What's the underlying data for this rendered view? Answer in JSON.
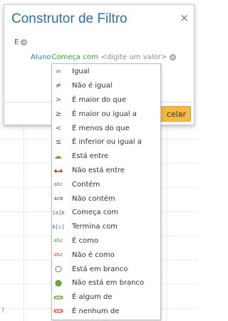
{
  "dialog": {
    "title": "Construtor de Filtro",
    "close_glyph": "×",
    "root_group": {
      "operator": "E",
      "add_glyph": "+"
    },
    "condition": {
      "field": "Aluno",
      "operator": "Começa com",
      "value_placeholder": "<digite um valor>",
      "remove_glyph": "×"
    },
    "cancel_button_label": "celar"
  },
  "background": {
    "row_digit": "7"
  },
  "menu": {
    "items": [
      {
        "label": "Igual",
        "icon": "equals-icon",
        "glyph": "="
      },
      {
        "label": "Não é igual",
        "icon": "not-equals-icon",
        "glyph": "≠"
      },
      {
        "label": "É maior do que",
        "icon": "greater-than-icon",
        "glyph": ">"
      },
      {
        "label": "É maior ou igual a",
        "icon": "greater-or-equal-icon",
        "glyph": "≥"
      },
      {
        "label": "É menos do que",
        "icon": "less-than-icon",
        "glyph": "<"
      },
      {
        "label": "É inferior ou igual a",
        "icon": "less-or-equal-icon",
        "glyph": "≤"
      },
      {
        "label": "Está entre",
        "icon": "between-icon",
        "glyph": ""
      },
      {
        "label": "Não está entre",
        "icon": "not-between-icon",
        "glyph": ""
      },
      {
        "label": "Contém",
        "icon": "contains-icon",
        "glyph": "abc"
      },
      {
        "label": "Não contém",
        "icon": "not-contains-icon",
        "glyph": "acb"
      },
      {
        "label": "Começa com",
        "icon": "begins-with-icon",
        "glyph": "[a]b"
      },
      {
        "label": "Termina com",
        "icon": "ends-with-icon",
        "glyph": "b[c]"
      },
      {
        "label": "É como",
        "icon": "like-icon",
        "glyph": "a%c"
      },
      {
        "label": "Não é como",
        "icon": "not-like-icon",
        "glyph": "a%c"
      },
      {
        "label": "Está em branco",
        "icon": "is-blank-icon",
        "glyph": ""
      },
      {
        "label": "Não está em branco",
        "icon": "is-not-blank-icon",
        "glyph": ""
      },
      {
        "label": "É algum de",
        "icon": "any-of-icon",
        "glyph": ""
      },
      {
        "label": "É nenhum de",
        "icon": "none-of-icon",
        "glyph": ""
      }
    ]
  },
  "colors": {
    "title": "#2f6fa8",
    "logic_operator": "#d32020",
    "field": "#2a80c2",
    "operator": "#3aa038",
    "cancel_button": "#f5b942"
  }
}
